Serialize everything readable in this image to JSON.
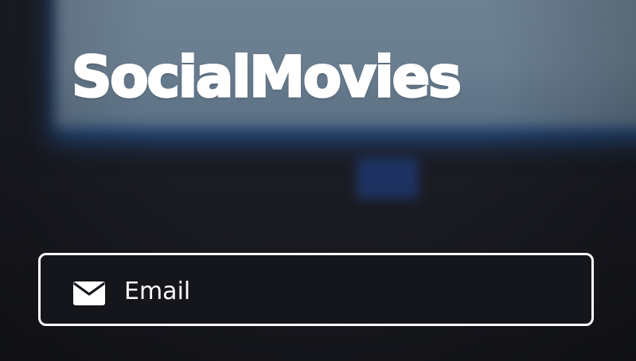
{
  "app": {
    "logo_text": "SocialMovies"
  },
  "login_form": {
    "email_field": {
      "icon": "mail-icon",
      "placeholder": "Email",
      "value": ""
    }
  },
  "colors": {
    "background": "#1a1b22",
    "text": "#ffffff",
    "field_border": "#ffffff"
  }
}
